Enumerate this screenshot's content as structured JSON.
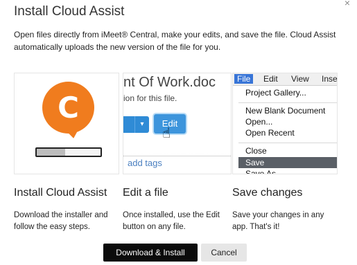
{
  "dialog": {
    "title": "Install Cloud Assist",
    "intro": "Open files directly from iMeet® Central, make your edits, and save the file. Cloud Assist automatically uploads the new version of the file for you.",
    "close_glyph": "×"
  },
  "steps": [
    {
      "heading": "Install Cloud Assist",
      "description": "Download the installer and follow the easy steps."
    },
    {
      "heading": "Edit a file",
      "description": "Once installed, use the Edit button on any file."
    },
    {
      "heading": "Save changes",
      "description": "Save your changes in any app. That's it!"
    }
  ],
  "panel1": {
    "logo_letter": "C",
    "logo_color": "#f07c1e",
    "progress": 0.45
  },
  "panel2": {
    "doc_title": "nt Of Work.doc",
    "doc_subtitle": "ion for this file.",
    "edit_button": "Edit",
    "add_tags": "add tags",
    "accent": "#2f8bd6"
  },
  "panel3": {
    "menubar": [
      "File",
      "Edit",
      "View",
      "Inse"
    ],
    "items": [
      "Project Gallery...",
      "New Blank Document",
      "Open...",
      "Open Recent",
      "Close",
      "Save",
      "Save As"
    ]
  },
  "buttons": {
    "primary": "Download & Install",
    "secondary": "Cancel"
  }
}
